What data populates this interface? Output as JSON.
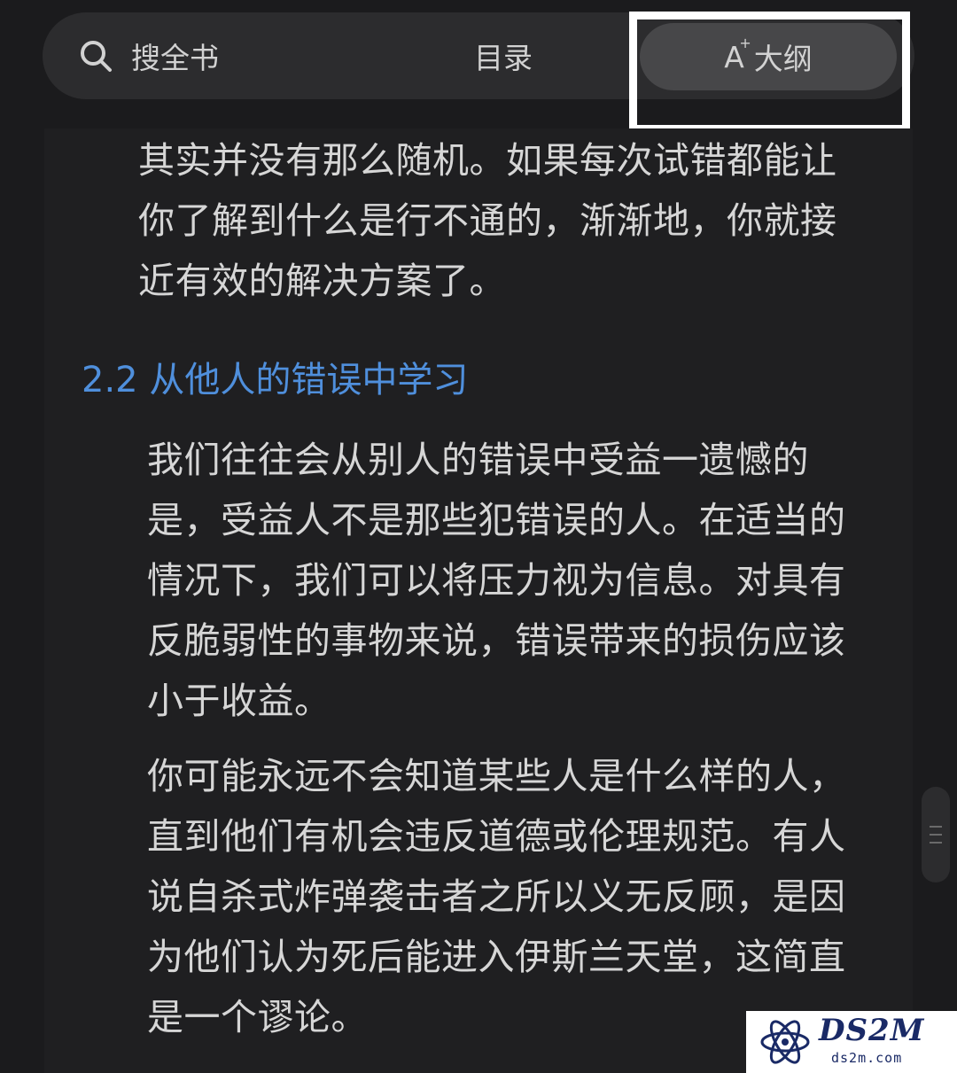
{
  "toolbar": {
    "search_label": "搜全书",
    "toc_label": "目录",
    "ai_glyph": "A",
    "outline_label": "大纲"
  },
  "content": {
    "para0": "其实并没有那么随机。如果每次试错都能让\n你了解到什么是行不通的，渐渐地，你就接\n近有效的解决方案了。",
    "heading": "2.2 从他人的错误中学习",
    "para1": "我们往往会从别人的错误中受益一遗憾的\n是，受益人不是那些犯错误的人。在适当的\n情况下，我们可以将压力视为信息。对具有\n反脆弱性的事物来说，错误带来的损伤应该\n小于收益。",
    "para2": "你可能永远不会知道某些人是什么样的人，\n直到他们有机会违反道德或伦理规范。有人\n说自杀式炸弹袭击者之所以义无反顾，是因\n为他们认为死后能进入伊斯兰天堂，这简直\n是一个谬论。"
  },
  "watermark": {
    "title": "DS2M",
    "url": "ds2m.com"
  },
  "icons": {
    "search": "search-icon",
    "ai": "ai-sparkle-icon",
    "scroll": "scroll-handle-icon"
  },
  "colors": {
    "background": "#1b1b1d",
    "toolbar": "#2c2c2e",
    "active_tab": "#474749",
    "heading": "#4f8fdc",
    "text": "#d6d6d6"
  }
}
